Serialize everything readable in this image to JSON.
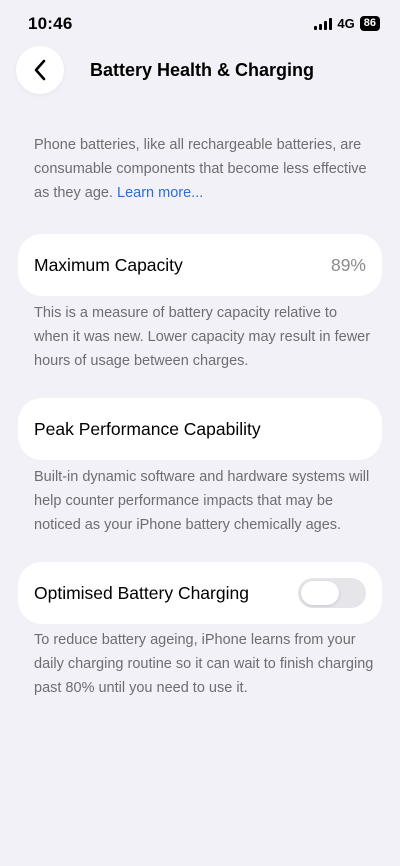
{
  "status_bar": {
    "time": "10:46",
    "network": "4G",
    "battery": "86"
  },
  "nav": {
    "title": "Battery Health & Charging"
  },
  "intro": {
    "text": "Phone batteries, like all rechargeable batteries, are consumable components that become less effective as they age. ",
    "link": "Learn more..."
  },
  "max_capacity": {
    "label": "Maximum Capacity",
    "value": "89%",
    "description": "This is a measure of battery capacity relative to when it was new. Lower capacity may result in fewer hours of usage between charges."
  },
  "peak_performance": {
    "label": "Peak Performance Capability",
    "description": "Built-in dynamic software and hardware systems will help counter performance impacts that may be noticed as your iPhone battery chemically ages."
  },
  "optimised_charging": {
    "label": "Optimised Battery Charging",
    "enabled": false,
    "description": "To reduce battery ageing, iPhone learns from your daily charging routine so it can wait to finish charging past 80% until you need to use it."
  }
}
